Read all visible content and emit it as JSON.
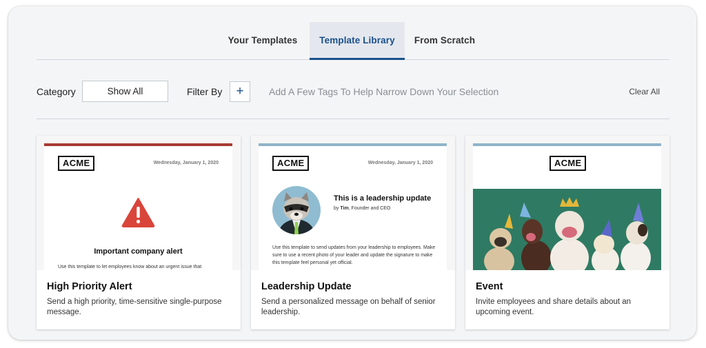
{
  "tabs": [
    {
      "label": "Your Templates",
      "active": false
    },
    {
      "label": "Template Library",
      "active": true
    },
    {
      "label": "From Scratch",
      "active": false
    }
  ],
  "filters": {
    "category_label": "Category",
    "category_value": "Show All",
    "filter_by_label": "Filter By",
    "add_tag_symbol": "+",
    "tag_placeholder": "Add A Few Tags To Help Narrow Down Your Selection",
    "clear_all": "Clear All"
  },
  "colors": {
    "accent": "#1a4f8b",
    "alert_bar": "#a83a32",
    "leadership_bar": "#8fb4c8",
    "event_bar": "#8fb4c8",
    "alert_icon": "#d9453a",
    "event_background": "#2f7a63"
  },
  "cards": [
    {
      "title": "High Priority Alert",
      "description": "Send a high priority, time-sensitive single-purpose message.",
      "preview": {
        "logo": "ACME",
        "date": "Wednesday, January 1, 2020",
        "icon": "warning-triangle-icon",
        "heading": "Important company alert",
        "body": "Use this template to let employees know about an urgent issue that"
      }
    },
    {
      "title": "Leadership Update",
      "description": "Send a personalized message on behalf of senior leadership.",
      "preview": {
        "logo": "ACME",
        "date": "Wednesday, January 1, 2020",
        "heading": "This is a leadership update",
        "byline_prefix": "by ",
        "byline_name": "Tim",
        "byline_role": ", Founder and CEO",
        "body": "Use this template to send updates from your leadership to employees. Make sure to use a recent photo of your leader and update the signature to make this template feel personal yet official."
      }
    },
    {
      "title": "Event",
      "description": "Invite employees and share details about an upcoming event.",
      "preview": {
        "logo": "ACME"
      }
    }
  ]
}
